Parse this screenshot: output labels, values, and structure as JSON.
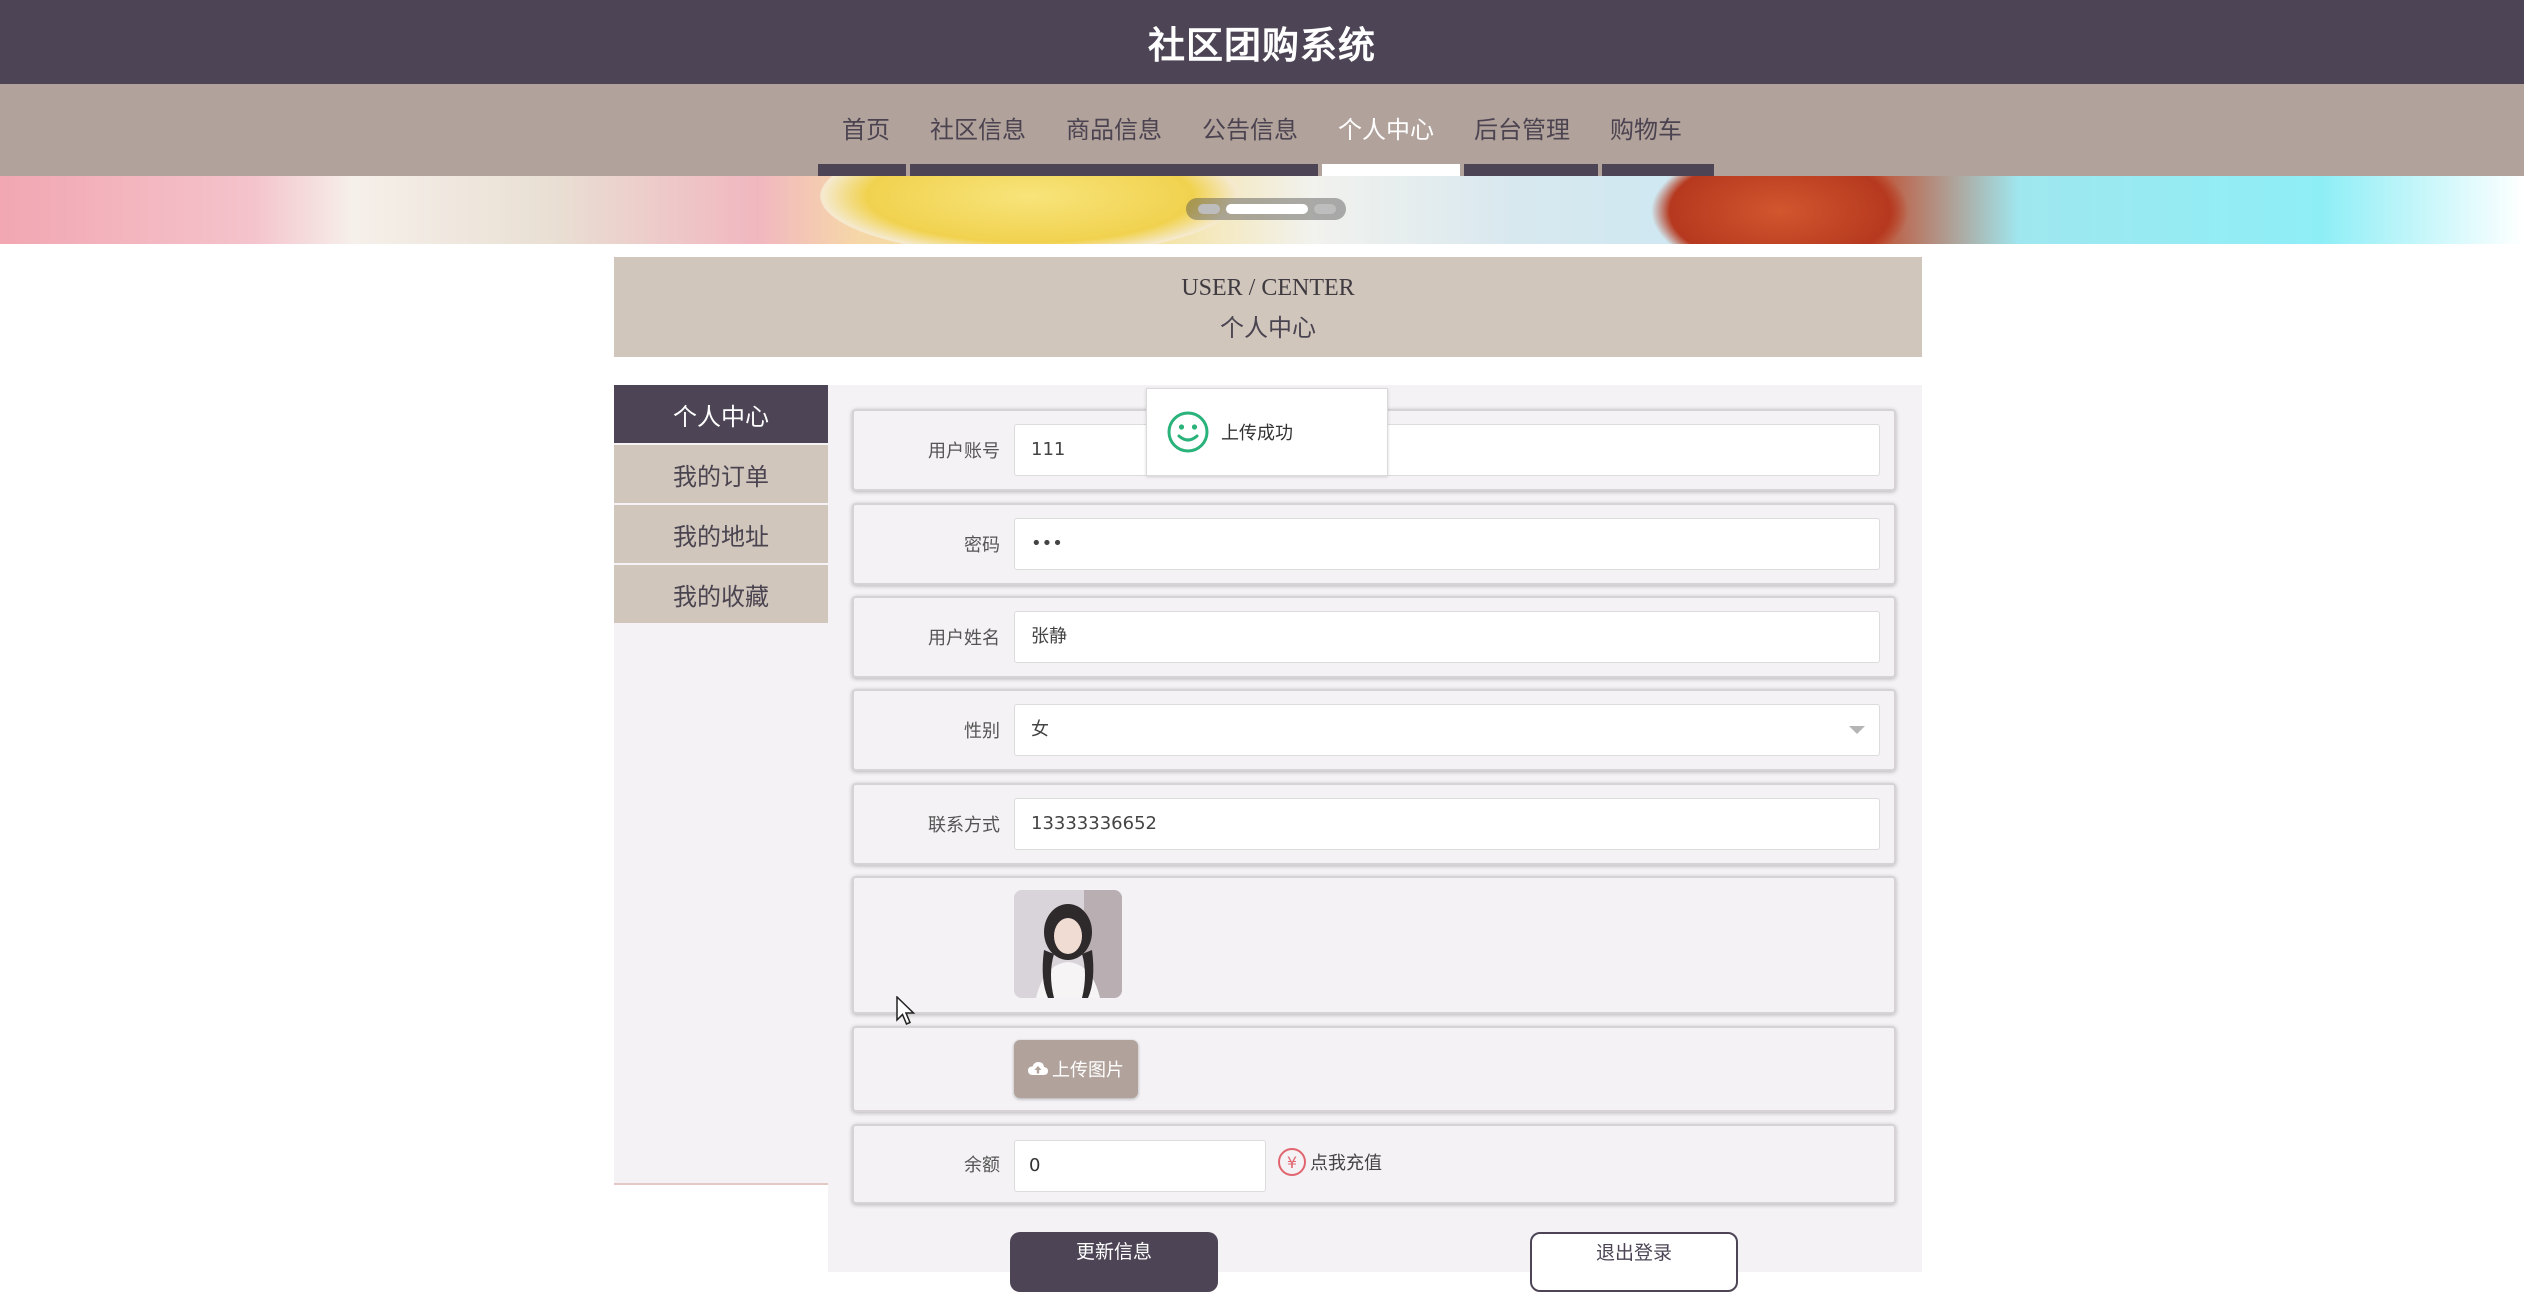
{
  "header": {
    "title": "社区团购系统"
  },
  "nav": {
    "items": [
      {
        "label": "首页"
      },
      {
        "label": "社区信息"
      },
      {
        "label": "商品信息"
      },
      {
        "label": "公告信息"
      },
      {
        "label": "个人中心",
        "active": true
      },
      {
        "label": "后台管理"
      },
      {
        "label": "购物车"
      }
    ]
  },
  "banner": {
    "slides": 3,
    "active_slide": 2
  },
  "section": {
    "title_en": "USER / CENTER",
    "title_cn": "个人中心"
  },
  "sidebar": {
    "items": [
      {
        "label": "个人中心",
        "active": true
      },
      {
        "label": "我的订单"
      },
      {
        "label": "我的地址"
      },
      {
        "label": "我的收藏"
      }
    ]
  },
  "form": {
    "account": {
      "label": "用户账号",
      "value": "111"
    },
    "password": {
      "label": "密码",
      "value": "•••"
    },
    "name": {
      "label": "用户姓名",
      "value": "张静"
    },
    "gender": {
      "label": "性别",
      "value": "女"
    },
    "phone": {
      "label": "联系方式",
      "value": "13333336652"
    },
    "upload_label": "上传图片",
    "balance": {
      "label": "余额",
      "value": "0"
    },
    "recharge_label": "点我充值"
  },
  "buttons": {
    "update": "更新信息",
    "logout": "退出登录"
  },
  "toast": {
    "message": "上传成功"
  },
  "colors": {
    "header_bg": "#4d4555",
    "nav_bg": "#b1a39c",
    "panel_bg": "#d0c6bc",
    "success": "#2ab27b",
    "recharge_icon": "#e0656f"
  }
}
